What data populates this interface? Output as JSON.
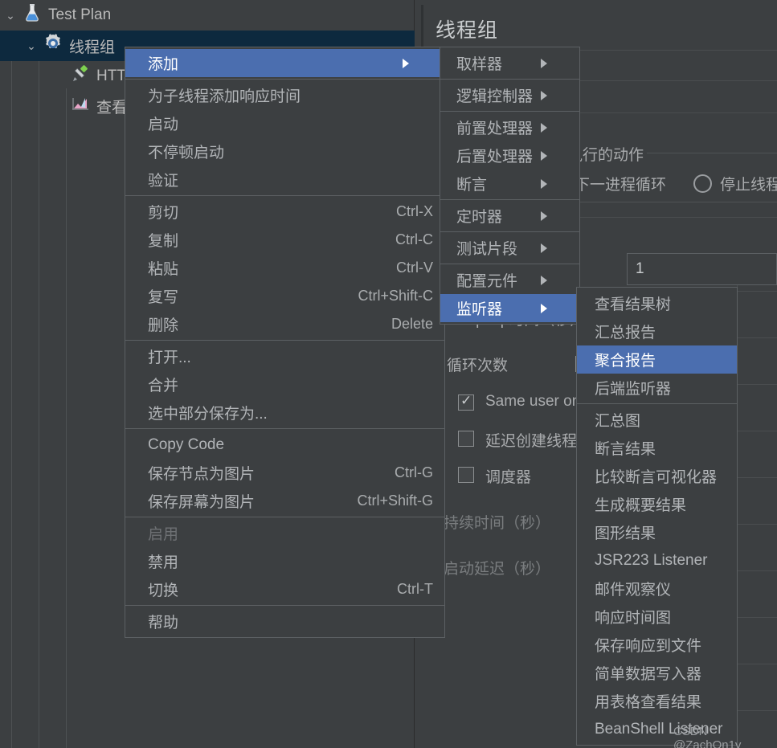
{
  "tree": {
    "nodes": [
      {
        "label": "Test Plan",
        "icon": "flask-icon",
        "chevron": "⌄",
        "depth": 1,
        "selected": false
      },
      {
        "label": "线程组",
        "icon": "gear-icon",
        "chevron": "⌄",
        "depth": 2,
        "selected": true
      },
      {
        "label": "HTTP",
        "icon": "http-icon",
        "chevron": "",
        "depth": 3,
        "selected": false
      },
      {
        "label": "查看",
        "icon": "chart-icon",
        "chevron": "",
        "depth": 3,
        "selected": false
      }
    ]
  },
  "panel": {
    "title": "线程组",
    "action_group_label": "执行的动作",
    "radio_next_loop": "动下一进程循环",
    "radio_stop_thread": "停止线程",
    "ramp_up_label": "Ramp-Up时间（秒）",
    "loop_count_label": "循环次数",
    "loop_count_value": "1",
    "same_user_label": "Same user on",
    "delay_create_label": "延迟创建线程",
    "scheduler_label": "调度器",
    "duration_label": "持续时间（秒）",
    "startup_delay_label": "启动延迟（秒）"
  },
  "menu_main": {
    "items": [
      {
        "label": "添加",
        "accel": "",
        "arrow": true,
        "highlight": true,
        "disabled": false
      },
      {
        "sep": true
      },
      {
        "label": "为子线程添加响应时间",
        "accel": "",
        "arrow": false,
        "highlight": false,
        "disabled": false
      },
      {
        "label": "启动",
        "accel": "",
        "arrow": false,
        "highlight": false,
        "disabled": false
      },
      {
        "label": "不停顿启动",
        "accel": "",
        "arrow": false,
        "highlight": false,
        "disabled": false
      },
      {
        "label": "验证",
        "accel": "",
        "arrow": false,
        "highlight": false,
        "disabled": false
      },
      {
        "sep": true
      },
      {
        "label": "剪切",
        "accel": "Ctrl-X",
        "arrow": false,
        "highlight": false,
        "disabled": false
      },
      {
        "label": "复制",
        "accel": "Ctrl-C",
        "arrow": false,
        "highlight": false,
        "disabled": false
      },
      {
        "label": "粘贴",
        "accel": "Ctrl-V",
        "arrow": false,
        "highlight": false,
        "disabled": false
      },
      {
        "label": "复写",
        "accel": "Ctrl+Shift-C",
        "arrow": false,
        "highlight": false,
        "disabled": false
      },
      {
        "label": "删除",
        "accel": "Delete",
        "arrow": false,
        "highlight": false,
        "disabled": false
      },
      {
        "sep": true
      },
      {
        "label": "打开...",
        "accel": "",
        "arrow": false,
        "highlight": false,
        "disabled": false
      },
      {
        "label": "合并",
        "accel": "",
        "arrow": false,
        "highlight": false,
        "disabled": false
      },
      {
        "label": "选中部分保存为...",
        "accel": "",
        "arrow": false,
        "highlight": false,
        "disabled": false
      },
      {
        "sep": true
      },
      {
        "label": "Copy Code",
        "accel": "",
        "arrow": false,
        "highlight": false,
        "disabled": false
      },
      {
        "label": "保存节点为图片",
        "accel": "Ctrl-G",
        "arrow": false,
        "highlight": false,
        "disabled": false
      },
      {
        "label": "保存屏幕为图片",
        "accel": "Ctrl+Shift-G",
        "arrow": false,
        "highlight": false,
        "disabled": false
      },
      {
        "sep": true
      },
      {
        "label": "启用",
        "accel": "",
        "arrow": false,
        "highlight": false,
        "disabled": true
      },
      {
        "label": "禁用",
        "accel": "",
        "arrow": false,
        "highlight": false,
        "disabled": false
      },
      {
        "label": "切换",
        "accel": "Ctrl-T",
        "arrow": false,
        "highlight": false,
        "disabled": false
      },
      {
        "sep": true
      },
      {
        "label": "帮助",
        "accel": "",
        "arrow": false,
        "highlight": false,
        "disabled": false
      }
    ]
  },
  "menu_add": {
    "items": [
      {
        "label": "取样器",
        "arrow": true,
        "highlight": false
      },
      {
        "sep": true
      },
      {
        "label": "逻辑控制器",
        "arrow": true,
        "highlight": false
      },
      {
        "sep": true
      },
      {
        "label": "前置处理器",
        "arrow": true,
        "highlight": false
      },
      {
        "label": "后置处理器",
        "arrow": true,
        "highlight": false
      },
      {
        "label": "断言",
        "arrow": true,
        "highlight": false
      },
      {
        "sep": true
      },
      {
        "label": "定时器",
        "arrow": true,
        "highlight": false
      },
      {
        "sep": true
      },
      {
        "label": "测试片段",
        "arrow": true,
        "highlight": false
      },
      {
        "sep": true
      },
      {
        "label": "配置元件",
        "arrow": true,
        "highlight": false
      },
      {
        "label": "监听器",
        "arrow": true,
        "highlight": true
      }
    ]
  },
  "menu_listener": {
    "items": [
      {
        "label": "查看结果树",
        "highlight": false
      },
      {
        "label": "汇总报告",
        "highlight": false
      },
      {
        "label": "聚合报告",
        "highlight": true
      },
      {
        "label": "后端监听器",
        "highlight": false
      },
      {
        "sep": true
      },
      {
        "label": "汇总图",
        "highlight": false
      },
      {
        "label": "断言结果",
        "highlight": false
      },
      {
        "label": "比较断言可视化器",
        "highlight": false
      },
      {
        "label": "生成概要结果",
        "highlight": false
      },
      {
        "label": "图形结果",
        "highlight": false
      },
      {
        "label": "JSR223 Listener",
        "highlight": false
      },
      {
        "label": "邮件观察仪",
        "highlight": false
      },
      {
        "label": "响应时间图",
        "highlight": false
      },
      {
        "label": "保存响应到文件",
        "highlight": false
      },
      {
        "label": "简单数据写入器",
        "highlight": false
      },
      {
        "label": "用表格查看结果",
        "highlight": false
      },
      {
        "label": "BeanShell Listener",
        "highlight": false
      }
    ]
  },
  "watermark": {
    "text": "CSDN @ZachOn1y"
  },
  "colors": {
    "background": "#3c3f41",
    "menu_background": "#3c3f41",
    "highlight": "#4b6eaf",
    "tree_selected": "#0d293e",
    "text": "#b2b5b8",
    "border": "#5c6063"
  }
}
